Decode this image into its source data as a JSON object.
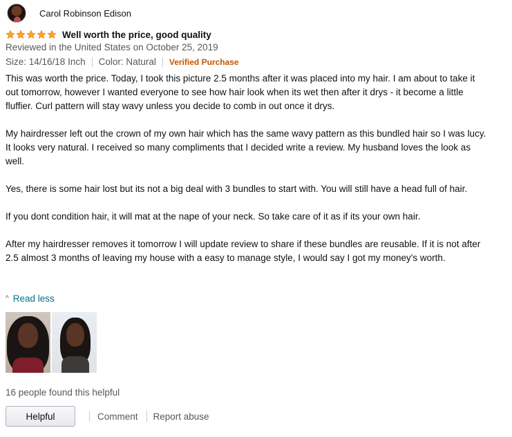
{
  "reviewer": {
    "name": "Carol Robinson Edison",
    "avatar_icon": "profile-avatar"
  },
  "review": {
    "rating": 5,
    "star_color": "#ffa41c",
    "title": "Well worth the price, good quality",
    "meta": "Reviewed in the United States on October 25, 2019",
    "size": "Size: 14/16/18 Inch",
    "color": "Color: Natural",
    "verified": "Verified Purchase",
    "paragraphs": [
      "This was worth the price. Today, I took this picture 2.5 months after it was placed into my hair. I am about to take it out tomorrow, however I wanted everyone to see how hair look when its wet then after it drys - it become a little fluffier. Curl pattern will stay wavy unless you decide to comb in out once it drys.",
      "My hairdresser left out the crown of my own hair which has the same wavy pattern as this bundled hair so I was lucy. It looks very natural. I received so many compliments that I decided write a review. My husband loves the look as well.",
      "Yes, there is some hair lost but its not a big deal with 3 bundles to start with. You will still have a head full of hair.",
      "If you dont condition hair, it will mat at the nape of your neck. So take care of it as if its your own hair.",
      "After my hairdresser removes it tomorrow I will update review to share if these bundles are reusable. If it is not after 2.5 almost 3 months of leaving my house with a easy to manage style, I would say I got my money's worth."
    ],
    "read_less": "Read less",
    "helpful_count": "16 people found this helpful"
  },
  "actions": {
    "helpful": "Helpful",
    "comment": "Comment",
    "report": "Report abuse"
  },
  "link_color": "#007185",
  "verified_color": "#c45500"
}
